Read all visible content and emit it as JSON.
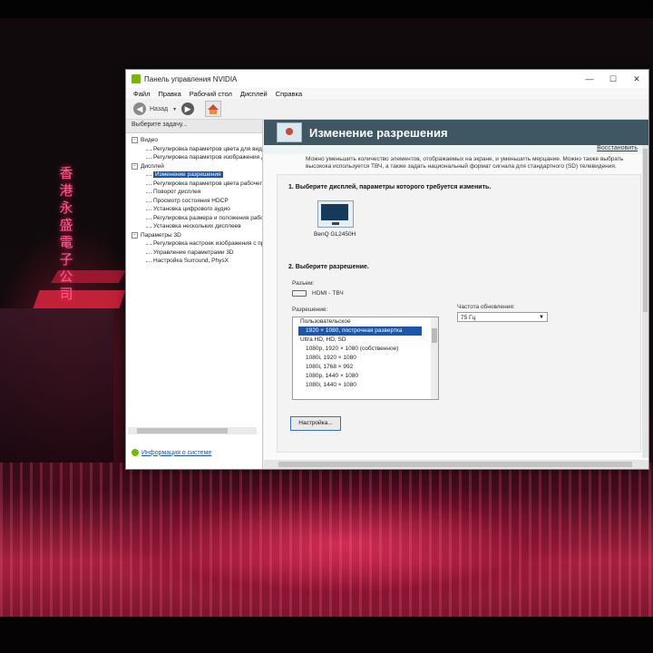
{
  "window": {
    "title": "Панель управления NVIDIA",
    "controls": {
      "minimize": "—",
      "maximize": "☐",
      "close": "✕"
    }
  },
  "wallpaper": {
    "sign_text": "香港永盛電子公司"
  },
  "menu": [
    "Файл",
    "Правка",
    "Рабочий стол",
    "Дисплей",
    "Справка"
  ],
  "toolbar": {
    "back_label": "Назад",
    "dropdown": "▾"
  },
  "left": {
    "task_header": "Выберите задачу...",
    "tree": [
      {
        "type": "cat",
        "label": "Видео"
      },
      {
        "type": "item",
        "label": "Регулировка параметров цвета для вид"
      },
      {
        "type": "item",
        "label": "Регулировка параметров изображения д"
      },
      {
        "type": "cat",
        "label": "Дисплей"
      },
      {
        "type": "item",
        "label": "Изменение разрешения",
        "selected": true
      },
      {
        "type": "item",
        "label": "Регулировка параметров цвета рабочег"
      },
      {
        "type": "item",
        "label": "Поворот дисплея"
      },
      {
        "type": "item",
        "label": "Просмотр состояния HDCP"
      },
      {
        "type": "item",
        "label": "Установка цифрового аудио"
      },
      {
        "type": "item",
        "label": "Регулировка размера и положения рабо"
      },
      {
        "type": "item",
        "label": "Установка нескольких дисплеев"
      },
      {
        "type": "cat",
        "label": "Параметры 3D"
      },
      {
        "type": "item",
        "label": "Регулировка настроек изображения с пр"
      },
      {
        "type": "item",
        "label": "Управление параметрами 3D"
      },
      {
        "type": "item",
        "label": "Настройка Surround, PhysX"
      }
    ],
    "system_info": "Информация о системе"
  },
  "page": {
    "title": "Изменение разрешения",
    "restore": "Восстановить",
    "description": "Можно уменьшить количество элементов, отображаемых на экране, и уменьшить мерцание. Можно также выбрать высокока используется ТВЧ, а также задать национальный формат сигнала для стандартного (SD) телевидения.",
    "step1": "1. Выберите дисплей, параметры которого требуется изменить.",
    "monitor_name": "BenQ GL2450H",
    "step2": "2. Выберите разрешение.",
    "connector_label": "Разъем:",
    "connector_value": "HDMI - ТВЧ",
    "resolution_label": "Разрешение:",
    "resolution_list": [
      {
        "type": "grp",
        "label": "Пользовательское"
      },
      {
        "type": "sel",
        "label": "1920 × 1080, построчная развертка"
      },
      {
        "type": "grp",
        "label": "Ultra HD, HD, SD"
      },
      {
        "type": "opt",
        "label": "1080p, 1920 × 1080 (собственное)"
      },
      {
        "type": "opt",
        "label": "1080i, 1920 × 1080"
      },
      {
        "type": "opt",
        "label": "1080i, 1768 × 992"
      },
      {
        "type": "opt",
        "label": "1080p, 1440 × 1080"
      },
      {
        "type": "opt",
        "label": "1080i, 1440 × 1080"
      }
    ],
    "refresh_label": "Частота обновления:",
    "refresh_value": "75 Гц",
    "settings_button": "Настройка..."
  }
}
